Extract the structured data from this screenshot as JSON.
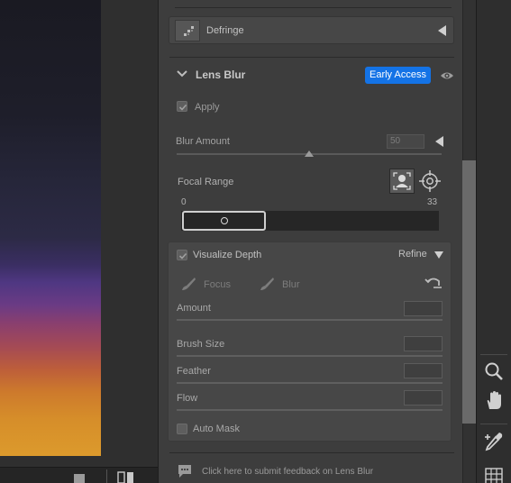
{
  "panel": {
    "defringe": {
      "label": "Defringe",
      "icon": "defringe-icon"
    },
    "lens_blur": {
      "title": "Lens Blur",
      "badge": "Early Access",
      "badge_color": "#1473e6",
      "apply": {
        "label": "Apply",
        "checked": true
      },
      "blur_amount": {
        "label": "Blur Amount",
        "value": "50",
        "max": 100
      },
      "focal_range": {
        "label": "Focal Range",
        "min": "0",
        "max": "33"
      },
      "visualize_depth": {
        "label": "Visualize Depth",
        "checked": true,
        "refine_label": "Refine",
        "tools": {
          "focus_label": "Focus",
          "blur_label": "Blur"
        },
        "params": [
          {
            "label": "Amount"
          },
          {
            "label": "Brush Size"
          },
          {
            "label": "Feather"
          },
          {
            "label": "Flow"
          }
        ],
        "auto_mask": {
          "label": "Auto Mask",
          "checked": false
        }
      },
      "feedback": "Click here to submit feedback on Lens Blur"
    }
  },
  "toolbar": {
    "tools": [
      "zoom-icon",
      "hand-icon",
      "color-sampler-icon",
      "grid-icon"
    ]
  }
}
